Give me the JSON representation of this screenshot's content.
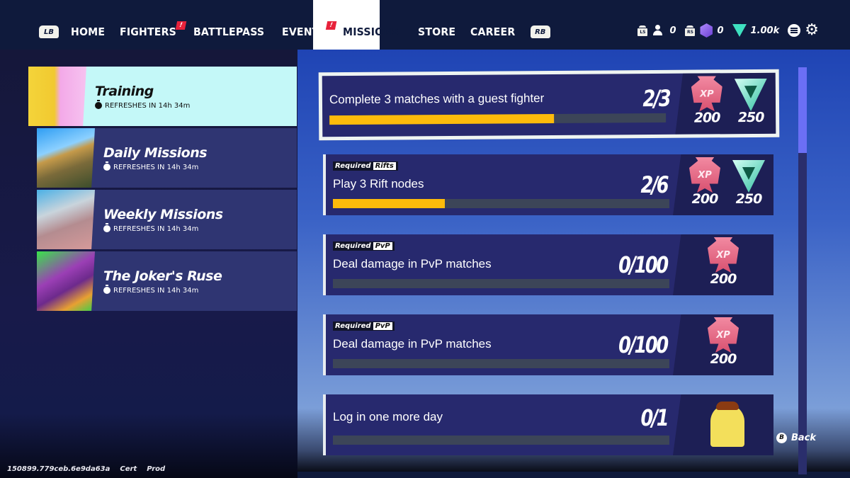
{
  "nav": {
    "left_bumper": "LB",
    "right_bumper": "RB",
    "items": [
      {
        "label": "HOME",
        "alert": null
      },
      {
        "label": "FIGHTERS",
        "alert": "!"
      },
      {
        "label": "BATTLEPASS",
        "alert": null
      },
      {
        "label": "EVENTS",
        "alert": "!"
      },
      {
        "label": "MISSIONS",
        "alert": null,
        "active": true
      },
      {
        "label": "STORE",
        "alert": null
      },
      {
        "label": "CAREER",
        "alert": null
      }
    ]
  },
  "currency": {
    "ls_label": "LS",
    "rs_label": "RS",
    "friends": "0",
    "gleamium": "0",
    "gold": "1.00k"
  },
  "categories": [
    {
      "title": "Training",
      "refresh": "REFRESHES IN 14h 34m",
      "active": true
    },
    {
      "title": "Daily Missions",
      "refresh": "REFRESHES IN 14h 34m"
    },
    {
      "title": "Weekly Missions",
      "refresh": "REFRESHES IN 14h 34m"
    },
    {
      "title": "The Joker's Ruse",
      "refresh": "REFRESHES IN 14h 34m"
    }
  ],
  "missions": [
    {
      "desc": "Complete 3 matches with a guest fighter",
      "count": "2/3",
      "progress": 0.6667,
      "required": null,
      "type": null,
      "rewards": [
        {
          "kind": "xp",
          "icon": "XP",
          "amount": "200"
        },
        {
          "kind": "gold",
          "amount": "250"
        }
      ]
    },
    {
      "desc": "Play 3 Rift nodes",
      "count": "2/6",
      "progress": 0.3333,
      "required": "Required",
      "type": "Rifts",
      "rewards": [
        {
          "kind": "xp",
          "icon": "XP",
          "amount": "200"
        },
        {
          "kind": "gold",
          "amount": "250"
        }
      ]
    },
    {
      "desc": "Deal damage in PvP matches",
      "count": "0/100",
      "progress": 0,
      "required": "Required",
      "type": "PvP",
      "rewards": [
        {
          "kind": "xp",
          "icon": "XP",
          "amount": "200"
        }
      ]
    },
    {
      "desc": "Deal damage in PvP matches",
      "count": "0/100",
      "progress": 0,
      "required": "Required",
      "type": "PvP",
      "rewards": [
        {
          "kind": "xp",
          "icon": "XP",
          "amount": "200"
        }
      ]
    },
    {
      "desc": "Log in one more day",
      "count": "0/1",
      "progress": 0,
      "required": null,
      "type": null,
      "rewards": [
        {
          "kind": "cosmetic"
        }
      ]
    }
  ],
  "scroll": {
    "visible_fraction": 0.21
  },
  "back": {
    "button": "B",
    "label": "Back"
  },
  "build": {
    "version": "150899.779ceb.6e9da63a",
    "env": "Cert",
    "stage": "Prod"
  },
  "colors": {
    "progress_fill": "#fdbb0b",
    "progress_track": "#3c4558",
    "alert": "#e8223b",
    "active_category": "#c4f8f8"
  }
}
